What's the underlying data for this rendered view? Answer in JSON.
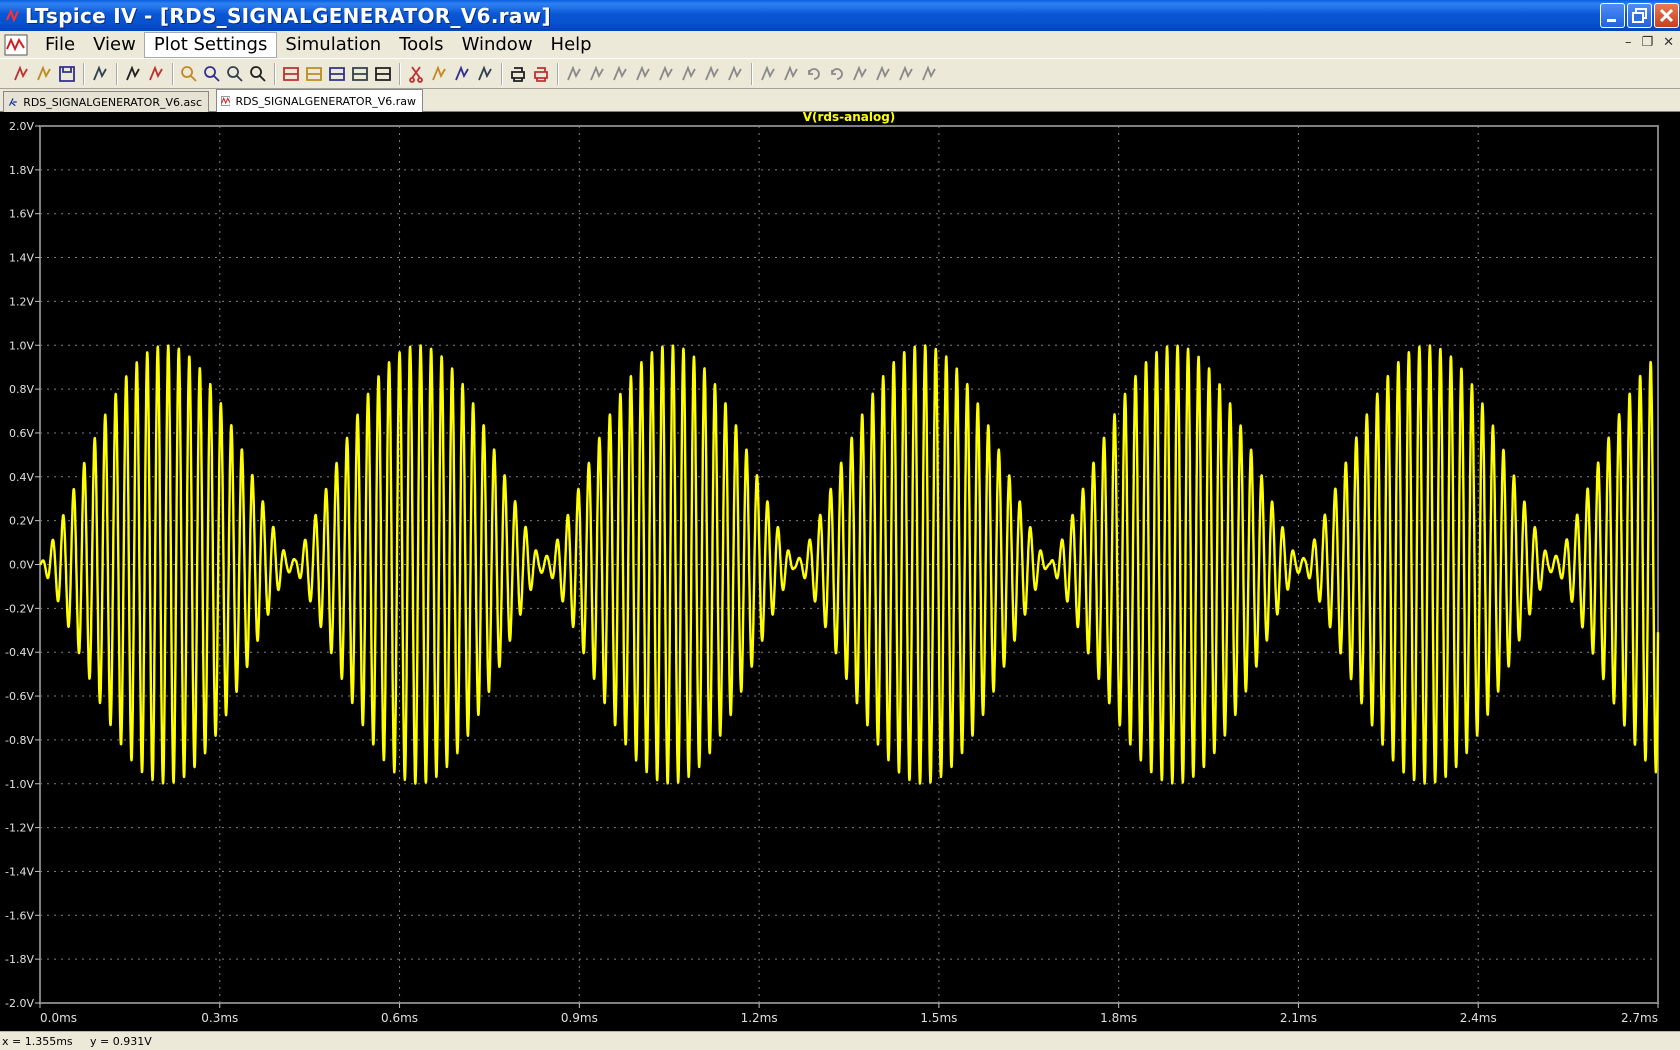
{
  "window": {
    "title": "LTspice IV - [RDS_SIGNALGENERATOR_V6.raw]"
  },
  "menu": [
    "File",
    "View",
    "Plot Settings",
    "Simulation",
    "Tools",
    "Window",
    "Help"
  ],
  "mdi_controls": [
    "–",
    "❐",
    "✕"
  ],
  "toolbar_icons": [
    "new-schematic-icon",
    "open-icon",
    "save-icon",
    "control-panel-icon",
    "run-icon",
    "halt-icon",
    "zoom-area-icon",
    "zoom-in-icon",
    "zoom-out-icon",
    "zoom-fit-icon",
    "autorange-icon",
    "manual-limits-icon",
    "tile-horizontal-icon",
    "cascade-icon",
    "tile-vertical-icon",
    "cut-icon",
    "copy-icon",
    "paste-icon",
    "find-icon",
    "print-preview-icon",
    "print-icon",
    "wire-icon",
    "ground-icon",
    "label-icon",
    "resistor-icon",
    "capacitor-icon",
    "inductor-icon",
    "diode-icon",
    "component-icon",
    "move-icon",
    "drag-icon",
    "undo-icon",
    "redo-icon",
    "rotate-icon",
    "mirror-icon",
    "text-icon",
    "spice-directive-icon"
  ],
  "tabs": [
    {
      "label": "RDS_SIGNALGENERATOR_V6.asc",
      "selected": false
    },
    {
      "label": "RDS_SIGNALGENERATOR_V6.raw",
      "selected": true
    }
  ],
  "plot": {
    "background": "#000000",
    "trace_color": "#ffff00",
    "grid_color": "#808080"
  },
  "chart_data": {
    "type": "line",
    "title": "V(rds-analog)",
    "xlabel": "",
    "ylabel": "",
    "xlim": [
      0,
      2.7
    ],
    "ylim": [
      -2.0,
      2.0
    ],
    "x_unit": "ms",
    "y_unit": "V",
    "grid": true,
    "x_ticks": [
      "0.0ms",
      "0.3ms",
      "0.6ms",
      "0.9ms",
      "1.2ms",
      "1.5ms",
      "1.8ms",
      "2.1ms",
      "2.4ms",
      "2.7ms"
    ],
    "y_ticks": [
      "2.0V",
      "1.8V",
      "1.6V",
      "1.4V",
      "1.2V",
      "1.0V",
      "0.8V",
      "0.6V",
      "0.4V",
      "0.2V",
      "0.0V",
      "-0.2V",
      "-0.4V",
      "-0.6V",
      "-0.8V",
      "-1.0V",
      "-1.2V",
      "-1.4V",
      "-1.6V",
      "-1.8V",
      "-2.0V"
    ],
    "series": [
      {
        "name": "V(rds-analog)",
        "description_values": {
          "carrier_frequency_kHz": 57,
          "envelope_period_ms": 0.421,
          "peak_amplitude_V": 1.0,
          "first_envelope_peak_ms": 0.21
        }
      }
    ]
  },
  "status": {
    "x": "x = 1.355ms",
    "y": "y = 0.931V"
  }
}
